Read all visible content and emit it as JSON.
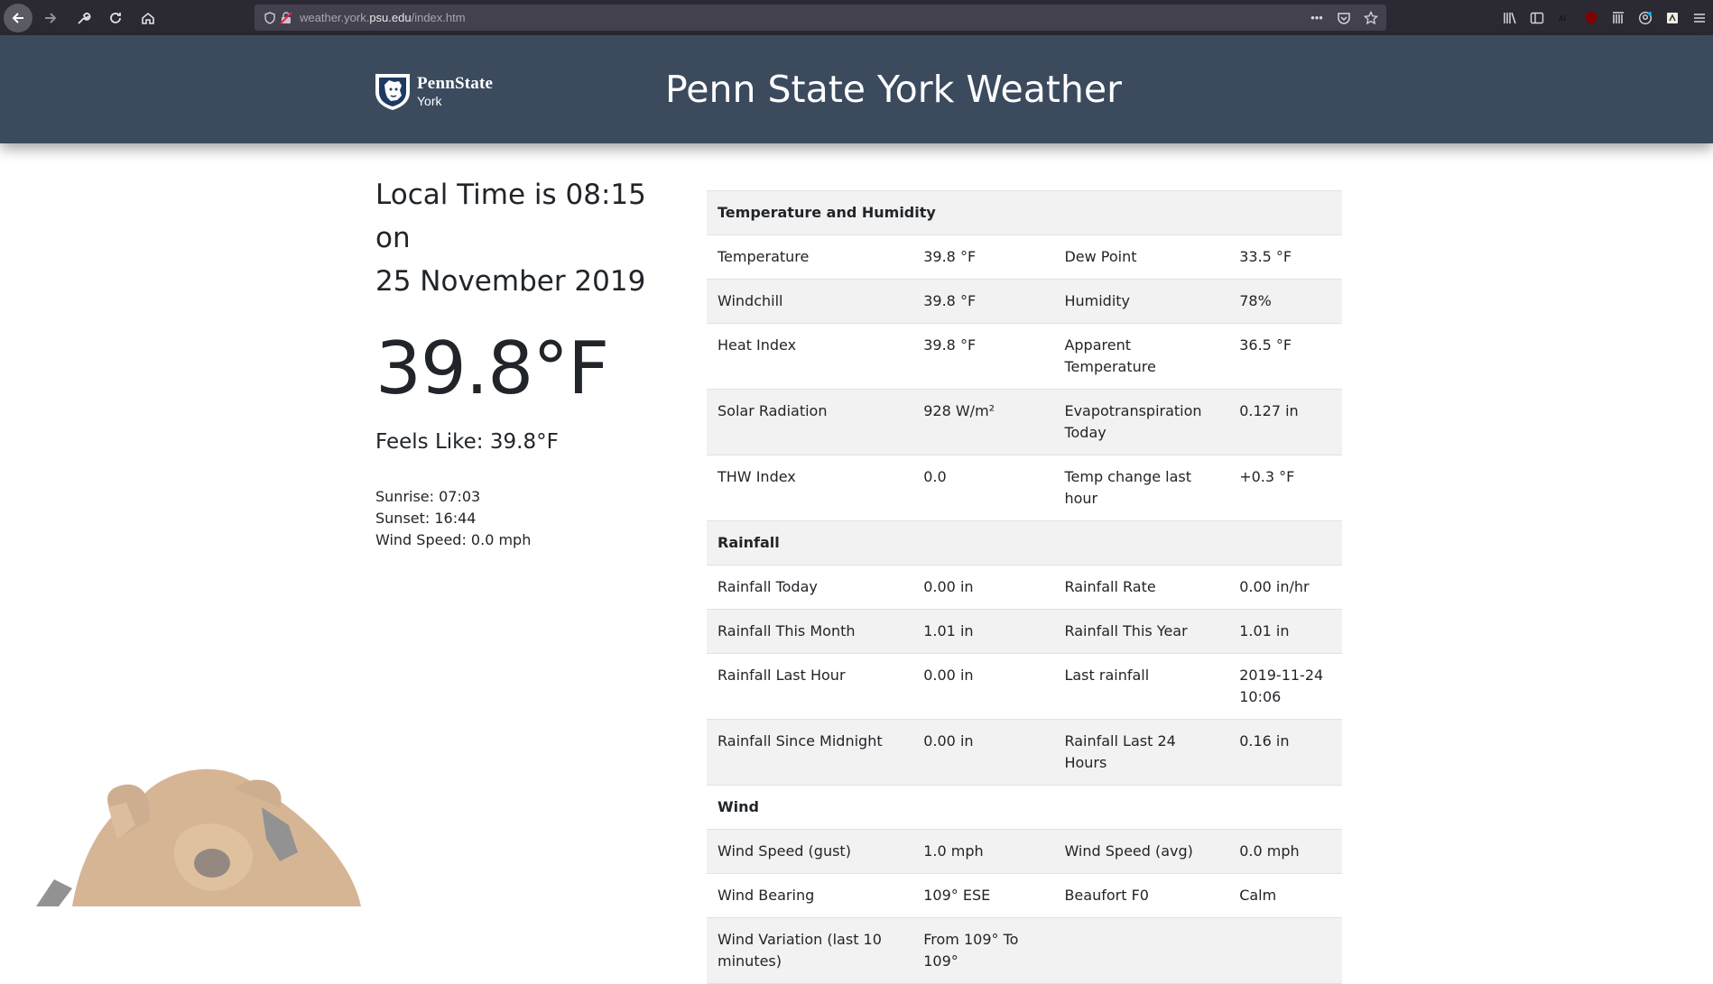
{
  "browser": {
    "url_prefix": "weather.york.",
    "url_domain": "psu.edu",
    "url_path": "/index.htm",
    "more_label": "•••"
  },
  "header": {
    "logo_name": "PennState",
    "logo_campus": "York",
    "title": "Penn State York Weather"
  },
  "summary": {
    "local_time_line1": "Local Time is 08:15 on",
    "local_time_line2": "25 November 2019",
    "temperature": "39.8°F",
    "feels_like": "Feels Like: 39.8°F",
    "sunrise": "Sunrise: 07:03",
    "sunset": "Sunset: 16:44",
    "wind_speed": "Wind Speed: 0.0 mph"
  },
  "sections": {
    "temp_humidity": "Temperature and Humidity",
    "rainfall": "Rainfall",
    "wind": "Wind"
  },
  "rows": [
    [
      "Temperature",
      "39.8 °F",
      "Dew Point",
      "33.5 °F"
    ],
    [
      "Windchill",
      "39.8 °F",
      "Humidity",
      "78%"
    ],
    [
      "Heat Index",
      "39.8 °F",
      "Apparent Temperature",
      "36.5 °F"
    ],
    [
      "Solar Radiation",
      "928 W/m²",
      "Evapotranspiration Today",
      "0.127 in"
    ],
    [
      "THW Index",
      "0.0",
      "Temp change last hour",
      "+0.3 °F"
    ],
    [
      "Rainfall Today",
      "0.00 in",
      "Rainfall Rate",
      "0.00 in/hr"
    ],
    [
      "Rainfall This Month",
      "1.01 in",
      "Rainfall This Year",
      "1.01 in"
    ],
    [
      "Rainfall Last Hour",
      "0.00 in",
      "Last rainfall",
      "2019-11-24 10:06"
    ],
    [
      "Rainfall Since Midnight",
      "0.00 in",
      "Rainfall Last 24 Hours",
      "0.16 in"
    ],
    [
      "Wind Speed (gust)",
      "1.0 mph",
      "Wind Speed (avg)",
      "0.0 mph"
    ],
    [
      "Wind Bearing",
      "109° ESE",
      "Beaufort F0",
      "Calm"
    ],
    [
      "Wind Variation (last 10 minutes)",
      "From 109° To 109°",
      "",
      ""
    ]
  ]
}
